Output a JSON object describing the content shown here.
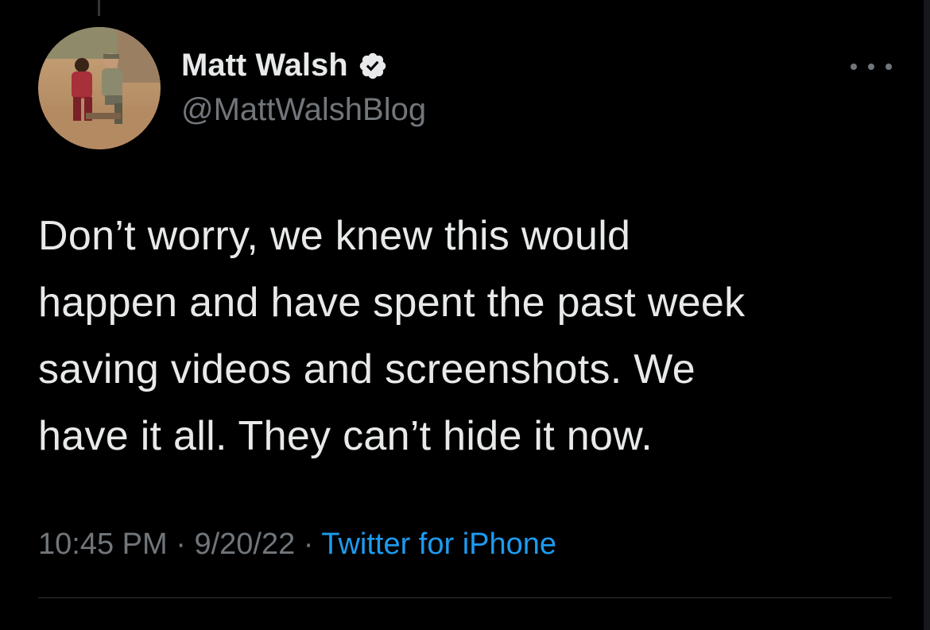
{
  "tweet": {
    "author": {
      "display_name": "Matt Walsh",
      "handle": "@MattWalshBlog",
      "verified": true,
      "verified_icon": "verified-badge-icon",
      "avatar_icon": "avatar-photo"
    },
    "text_lines": [
      "Don’t worry, we knew this would",
      "happen and have spent the past week",
      "saving videos and screenshots. We",
      "have it all. They can’t hide it now."
    ],
    "time": "10:45 PM",
    "separator": "·",
    "date": "9/20/22",
    "source": "Twitter for iPhone",
    "more_icon": "more-options-icon"
  },
  "colors": {
    "background": "#000000",
    "primary_text": "#e7e9ea",
    "secondary_text": "#71767b",
    "link": "#1d9bf0",
    "divider": "#2f3336"
  }
}
